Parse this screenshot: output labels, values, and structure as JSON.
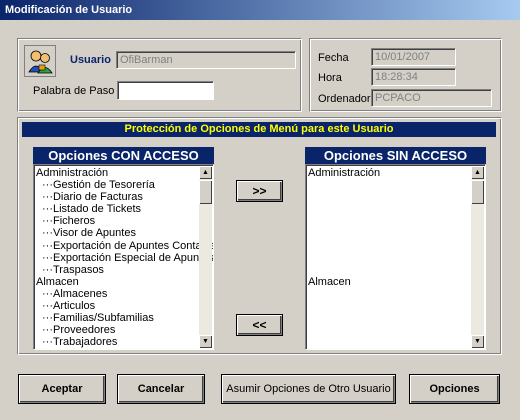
{
  "window": {
    "title": "Modificación de Usuario"
  },
  "user": {
    "usuario_label": "Usuario",
    "usuario_value": "OfiBarman",
    "password_label": "Palabra de Paso :",
    "password_value": ""
  },
  "info": {
    "fecha_label": "Fecha",
    "fecha_value": "10/01/2007",
    "hora_label": "Hora",
    "hora_value": "18:28:34",
    "ordenador_label": "Ordenador",
    "ordenador_value": "PCPACO"
  },
  "protection": {
    "title": "Protección de Opciones de Menú para este Usuario",
    "con_acceso_header": "Opciones CON ACCESO",
    "sin_acceso_header": "Opciones SIN ACCESO",
    "add_button": ">>",
    "remove_button": "<<",
    "con_acceso_items": [
      {
        "label": "Administración",
        "child": false
      },
      {
        "label": "···Gestión de Tesorería",
        "child": true
      },
      {
        "label": "···Diario de Facturas",
        "child": true
      },
      {
        "label": "···Listado de Tickets",
        "child": true
      },
      {
        "label": "···Ficheros",
        "child": true
      },
      {
        "label": "···Visor de Apuntes",
        "child": true
      },
      {
        "label": "···Exportación de Apuntes Contables",
        "child": true
      },
      {
        "label": "···Exportación Especial de Apuntes",
        "child": true
      },
      {
        "label": "···Traspasos",
        "child": true
      },
      {
        "label": "Almacen",
        "child": false
      },
      {
        "label": "···Almacenes",
        "child": true
      },
      {
        "label": "···Articulos",
        "child": true
      },
      {
        "label": "···Familias/Subfamilias",
        "child": true
      },
      {
        "label": "···Proveedores",
        "child": true
      },
      {
        "label": "···Trabajadores",
        "child": true
      }
    ],
    "sin_acceso_items": [
      {
        "label": "Administración",
        "gap_after": 8
      },
      {
        "label": "Almacen",
        "gap_after": 0
      }
    ]
  },
  "buttons": {
    "aceptar": "Aceptar",
    "cancelar": "Cancelar",
    "asumir": "Asumir Opciones de Otro Usuario",
    "opciones": "Opciones"
  },
  "icons": {
    "users_icon": "users-icon",
    "scroll_up": "scroll-up-arrow-icon",
    "scroll_down": "scroll-down-arrow-icon"
  }
}
